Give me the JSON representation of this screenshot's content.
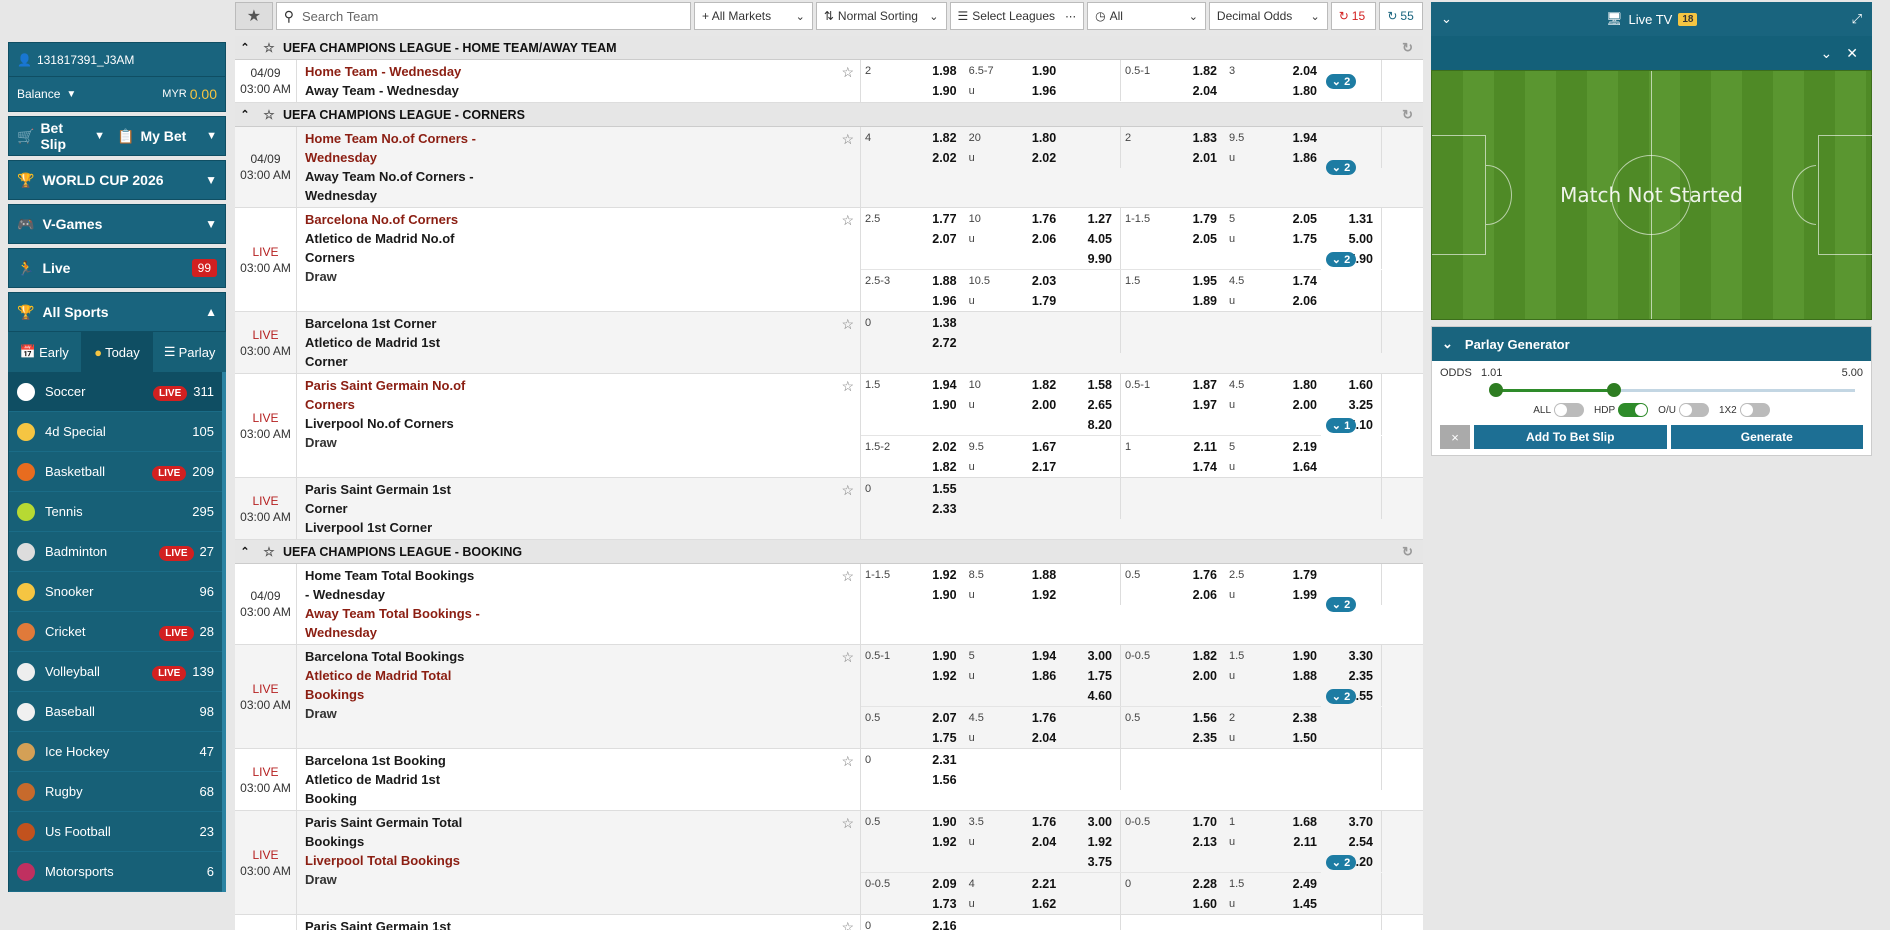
{
  "user": {
    "id": "131817391_J3AM",
    "balance_label": "Balance",
    "currency": "MYR",
    "amount": "0.00"
  },
  "sidebar": {
    "bet_slip": "Bet Slip",
    "my_bet": "My Bet",
    "world_cup": "WORLD CUP 2026",
    "vgames": "V-Games",
    "live": "Live",
    "live_count": "99",
    "all_sports": "All Sports",
    "tabs": [
      "Early",
      "Today",
      "Parlay"
    ],
    "sports": [
      {
        "name": "Soccer",
        "live": "LIVE",
        "count": "311",
        "color": "#ffffff"
      },
      {
        "name": "4d Special",
        "live": "",
        "count": "105",
        "color": "#f5c542"
      },
      {
        "name": "Basketball",
        "live": "LIVE",
        "count": "209",
        "color": "#e86c1f"
      },
      {
        "name": "Tennis",
        "live": "",
        "count": "295",
        "color": "#b7d933"
      },
      {
        "name": "Badminton",
        "live": "LIVE",
        "count": "27",
        "color": "#dddddd"
      },
      {
        "name": "Snooker",
        "live": "",
        "count": "96",
        "color": "#f5c542"
      },
      {
        "name": "Cricket",
        "live": "LIVE",
        "count": "28",
        "color": "#e07a3a"
      },
      {
        "name": "Volleyball",
        "live": "LIVE",
        "count": "139",
        "color": "#eeeeee"
      },
      {
        "name": "Baseball",
        "live": "",
        "count": "98",
        "color": "#f0f0f0"
      },
      {
        "name": "Ice Hockey",
        "live": "",
        "count": "47",
        "color": "#d4a056"
      },
      {
        "name": "Rugby",
        "live": "",
        "count": "68",
        "color": "#c76a2c"
      },
      {
        "name": "Us Football",
        "live": "",
        "count": "23",
        "color": "#c2521e"
      },
      {
        "name": "Motorsports",
        "live": "",
        "count": "6",
        "color": "#c03060"
      }
    ]
  },
  "topbar": {
    "search_placeholder": "Search Team",
    "markets": "+ All Markets",
    "sorting": "Normal Sorting",
    "leagues": "Select Leagues",
    "all": "All",
    "odds_type": "Decimal Odds",
    "refresh_a": "15",
    "refresh_b": "55"
  },
  "leagues": [
    {
      "title": "UEFA CHAMPIONS LEAGUE - HOME TEAM/AWAY TEAM"
    },
    {
      "title": "UEFA CHAMPIONS LEAGUE - CORNERS"
    },
    {
      "title": "UEFA CHAMPIONS LEAGUE - BOOKING"
    }
  ],
  "rows": [
    {
      "date": "04/09",
      "time": "03:00 AM",
      "live": "",
      "teams": [
        [
          "Home Team - Wednesday",
          "red"
        ],
        [
          "Away Team - Wednesday",
          "blk"
        ]
      ],
      "more": "2",
      "alt": false,
      "lines": [
        {
          "fh": [
            "2",
            ""
          ],
          "fho": [
            "1.98",
            "1.90"
          ],
          "fl": [
            "6.5-7",
            "u"
          ],
          "flo": [
            "1.90",
            "1.96"
          ],
          "fx": [
            "",
            ""
          ],
          "hh": [
            "0.5-1",
            ""
          ],
          "hho": [
            "1.82",
            "2.04"
          ],
          "hl": [
            "3",
            ""
          ],
          "hlo": [
            "2.04",
            "1.80"
          ],
          "hx": [
            "",
            ""
          ]
        }
      ]
    },
    {
      "date": "04/09",
      "time": "03:00 AM",
      "live": "",
      "teams": [
        [
          "Home Team No.of Corners - Wednesday",
          "red"
        ],
        [
          "Away Team No.of Corners - Wednesday",
          "blk"
        ]
      ],
      "more": "2",
      "alt": true,
      "lines": [
        {
          "fh": [
            "4",
            ""
          ],
          "fho": [
            "1.82",
            "2.02"
          ],
          "fl": [
            "20",
            "u"
          ],
          "flo": [
            "1.80",
            "2.02"
          ],
          "fx": [
            "",
            ""
          ],
          "hh": [
            "2",
            ""
          ],
          "hho": [
            "1.83",
            "2.01"
          ],
          "hl": [
            "9.5",
            "u"
          ],
          "hlo": [
            "1.94",
            "1.86"
          ],
          "hx": [
            "",
            ""
          ]
        }
      ]
    },
    {
      "date": "",
      "time": "03:00 AM",
      "live": "LIVE",
      "teams": [
        [
          "Barcelona No.of Corners",
          "red"
        ],
        [
          "Atletico de Madrid No.of Corners",
          "blk"
        ],
        [
          "Draw",
          "drw"
        ]
      ],
      "more": "2",
      "alt": false,
      "lines": [
        {
          "fh": [
            "2.5",
            ""
          ],
          "fho": [
            "1.77",
            "2.07"
          ],
          "fl": [
            "10",
            "u"
          ],
          "flo": [
            "1.76",
            "2.06"
          ],
          "fx": [
            "1.27",
            "4.05",
            "9.90"
          ],
          "hh": [
            "1-1.5",
            ""
          ],
          "hho": [
            "1.79",
            "2.05"
          ],
          "hl": [
            "5",
            "u"
          ],
          "hlo": [
            "2.05",
            "1.75"
          ],
          "hx": [
            "1.31",
            "5.00",
            "5.90"
          ]
        },
        {
          "fh": [
            "2.5-3",
            ""
          ],
          "fho": [
            "1.88",
            "1.96"
          ],
          "fl": [
            "10.5",
            "u"
          ],
          "flo": [
            "2.03",
            "1.79"
          ],
          "fx": [
            "",
            ""
          ],
          "hh": [
            "1.5",
            ""
          ],
          "hho": [
            "1.95",
            "1.89"
          ],
          "hl": [
            "4.5",
            "u"
          ],
          "hlo": [
            "1.74",
            "2.06"
          ],
          "hx": [
            "",
            ""
          ]
        }
      ]
    },
    {
      "date": "",
      "time": "03:00 AM",
      "live": "LIVE",
      "teams": [
        [
          "Barcelona 1st Corner",
          "blk"
        ],
        [
          "Atletico de Madrid 1st Corner",
          "blk"
        ]
      ],
      "more": "",
      "alt": true,
      "lines": [
        {
          "fh": [
            "0",
            ""
          ],
          "fho": [
            "1.38",
            "2.72"
          ],
          "fl": [
            "",
            ""
          ],
          "flo": [
            "",
            ""
          ],
          "fx": [
            "",
            ""
          ],
          "hh": [
            "",
            ""
          ],
          "hho": [
            "",
            ""
          ],
          "hl": [
            "",
            ""
          ],
          "hlo": [
            "",
            ""
          ],
          "hx": [
            "",
            ""
          ]
        }
      ]
    },
    {
      "date": "",
      "time": "03:00 AM",
      "live": "LIVE",
      "teams": [
        [
          "Paris Saint Germain No.of Corners",
          "red"
        ],
        [
          "Liverpool No.of Corners",
          "blk"
        ],
        [
          "Draw",
          "drw"
        ]
      ],
      "more": "1",
      "alt": false,
      "lines": [
        {
          "fh": [
            "1.5",
            ""
          ],
          "fho": [
            "1.94",
            "1.90"
          ],
          "fl": [
            "10",
            "u"
          ],
          "flo": [
            "1.82",
            "2.00"
          ],
          "fx": [
            "1.58",
            "2.65",
            "8.20"
          ],
          "hh": [
            "0.5-1",
            ""
          ],
          "hho": [
            "1.87",
            "1.97"
          ],
          "hl": [
            "4.5",
            "u"
          ],
          "hlo": [
            "1.80",
            "2.00"
          ],
          "hx": [
            "1.60",
            "3.25",
            "5.10"
          ]
        },
        {
          "fh": [
            "1.5-2",
            ""
          ],
          "fho": [
            "2.02",
            "1.82"
          ],
          "fl": [
            "9.5",
            "u"
          ],
          "flo": [
            "1.67",
            "2.17"
          ],
          "fx": [
            "",
            ""
          ],
          "hh": [
            "1",
            ""
          ],
          "hho": [
            "2.11",
            "1.74"
          ],
          "hl": [
            "5",
            "u"
          ],
          "hlo": [
            "2.19",
            "1.64"
          ],
          "hx": [
            "",
            ""
          ]
        }
      ]
    },
    {
      "date": "",
      "time": "03:00 AM",
      "live": "LIVE",
      "teams": [
        [
          "Paris Saint Germain 1st Corner",
          "blk"
        ],
        [
          "Liverpool 1st Corner",
          "blk"
        ]
      ],
      "more": "",
      "alt": true,
      "lines": [
        {
          "fh": [
            "0",
            ""
          ],
          "fho": [
            "1.55",
            "2.33"
          ],
          "fl": [
            "",
            ""
          ],
          "flo": [
            "",
            ""
          ],
          "fx": [
            "",
            ""
          ],
          "hh": [
            "",
            ""
          ],
          "hho": [
            "",
            ""
          ],
          "hl": [
            "",
            ""
          ],
          "hlo": [
            "",
            ""
          ],
          "hx": [
            "",
            ""
          ]
        }
      ]
    },
    {
      "date": "04/09",
      "time": "03:00 AM",
      "live": "",
      "teams": [
        [
          "Home Team Total Bookings - Wednesday",
          "blk"
        ],
        [
          "Away Team Total Bookings - Wednesday",
          "red"
        ]
      ],
      "more": "2",
      "alt": false,
      "lines": [
        {
          "fh": [
            "",
            "1-1.5"
          ],
          "fho": [
            "1.92",
            "1.90"
          ],
          "fl": [
            "8.5",
            "u"
          ],
          "flo": [
            "1.88",
            "1.92"
          ],
          "fx": [
            "",
            ""
          ],
          "hh": [
            "",
            "0.5"
          ],
          "hho": [
            "1.76",
            "2.06"
          ],
          "hl": [
            "2.5",
            "u"
          ],
          "hlo": [
            "1.79",
            "1.99"
          ],
          "hx": [
            "",
            ""
          ]
        }
      ]
    },
    {
      "date": "",
      "time": "03:00 AM",
      "live": "LIVE",
      "teams": [
        [
          "Barcelona Total Bookings",
          "blk"
        ],
        [
          "Atletico de Madrid Total Bookings",
          "red"
        ],
        [
          "Draw",
          "drw"
        ]
      ],
      "more": "2",
      "alt": true,
      "lines": [
        {
          "fh": [
            "",
            "0.5-1"
          ],
          "fho": [
            "1.90",
            "1.92"
          ],
          "fl": [
            "5",
            "u"
          ],
          "flo": [
            "1.94",
            "1.86"
          ],
          "fx": [
            "3.00",
            "1.75",
            "4.60"
          ],
          "hh": [
            "",
            "0-0.5"
          ],
          "hho": [
            "1.82",
            "2.00"
          ],
          "hl": [
            "1.5",
            "u"
          ],
          "hlo": [
            "1.90",
            "1.88"
          ],
          "hx": [
            "3.30",
            "2.35",
            "2.55"
          ]
        },
        {
          "fh": [
            "",
            "0.5"
          ],
          "fho": [
            "2.07",
            "1.75"
          ],
          "fl": [
            "4.5",
            "u"
          ],
          "flo": [
            "1.76",
            "2.04"
          ],
          "fx": [
            "",
            ""
          ],
          "hh": [
            "",
            "0.5"
          ],
          "hho": [
            "1.56",
            "2.35"
          ],
          "hl": [
            "2",
            "u"
          ],
          "hlo": [
            "2.38",
            "1.50"
          ],
          "hx": [
            "",
            ""
          ]
        }
      ]
    },
    {
      "date": "",
      "time": "03:00 AM",
      "live": "LIVE",
      "teams": [
        [
          "Barcelona 1st Booking",
          "blk"
        ],
        [
          "Atletico de Madrid 1st Booking",
          "blk"
        ]
      ],
      "more": "",
      "alt": false,
      "lines": [
        {
          "fh": [
            "0",
            ""
          ],
          "fho": [
            "2.31",
            "1.56"
          ],
          "fl": [
            "",
            ""
          ],
          "flo": [
            "",
            ""
          ],
          "fx": [
            "",
            ""
          ],
          "hh": [
            "",
            ""
          ],
          "hho": [
            "",
            ""
          ],
          "hl": [
            "",
            ""
          ],
          "hlo": [
            "",
            ""
          ],
          "hx": [
            "",
            ""
          ]
        }
      ]
    },
    {
      "date": "",
      "time": "03:00 AM",
      "live": "LIVE",
      "teams": [
        [
          "Paris Saint Germain Total Bookings",
          "blk"
        ],
        [
          "Liverpool Total Bookings",
          "red"
        ],
        [
          "Draw",
          "drw"
        ]
      ],
      "more": "2",
      "alt": true,
      "lines": [
        {
          "fh": [
            "",
            "0.5"
          ],
          "fho": [
            "1.90",
            "1.92"
          ],
          "fl": [
            "3.5",
            "u"
          ],
          "flo": [
            "1.76",
            "2.04"
          ],
          "fx": [
            "3.00",
            "1.92",
            "3.75"
          ],
          "hh": [
            "",
            "0-0.5"
          ],
          "hho": [
            "1.70",
            "2.13"
          ],
          "hl": [
            "1",
            "u"
          ],
          "hlo": [
            "1.68",
            "2.11"
          ],
          "hx": [
            "3.70",
            "2.54",
            "2.20"
          ]
        },
        {
          "fh": [
            "",
            "0-0.5"
          ],
          "fho": [
            "2.09",
            "1.73"
          ],
          "fl": [
            "4",
            "u"
          ],
          "flo": [
            "2.21",
            "1.62"
          ],
          "fx": [
            "",
            ""
          ],
          "hh": [
            "0",
            ""
          ],
          "hho": [
            "2.28",
            "1.60"
          ],
          "hl": [
            "1.5",
            "u"
          ],
          "hlo": [
            "2.49",
            "1.45"
          ],
          "hx": [
            "",
            ""
          ]
        }
      ]
    },
    {
      "date": "",
      "time": "",
      "live": "LIVE",
      "teams": [
        [
          "Paris Saint Germain 1st Booking",
          "blk"
        ]
      ],
      "more": "",
      "alt": false,
      "lines": [
        {
          "fh": [
            "0",
            ""
          ],
          "fho": [
            "2.16",
            ""
          ],
          "fl": [
            "",
            ""
          ],
          "flo": [
            "",
            ""
          ],
          "fx": [
            "",
            ""
          ],
          "hh": [
            "",
            ""
          ],
          "hho": [
            "",
            ""
          ],
          "hl": [
            "",
            ""
          ],
          "hlo": [
            "",
            ""
          ],
          "hx": [
            "",
            ""
          ]
        }
      ]
    }
  ],
  "league_breaks": {
    "0": 0,
    "1": 1,
    "6": 2
  },
  "tv": {
    "title": "Live TV",
    "count": "18",
    "status": "Match Not Started"
  },
  "parlay": {
    "title": "Parlay Generator",
    "odds_label": "ODDS",
    "min": "1.01",
    "max": "5.00",
    "range_low": 0.0,
    "range_high": 0.33,
    "toggles": [
      {
        "label": "ALL",
        "on": false
      },
      {
        "label": "HDP",
        "on": true
      },
      {
        "label": "O/U",
        "on": false
      },
      {
        "label": "1X2",
        "on": false
      }
    ],
    "add_label": "Add To Bet Slip",
    "generate_label": "Generate",
    "close_glyph": "×"
  }
}
